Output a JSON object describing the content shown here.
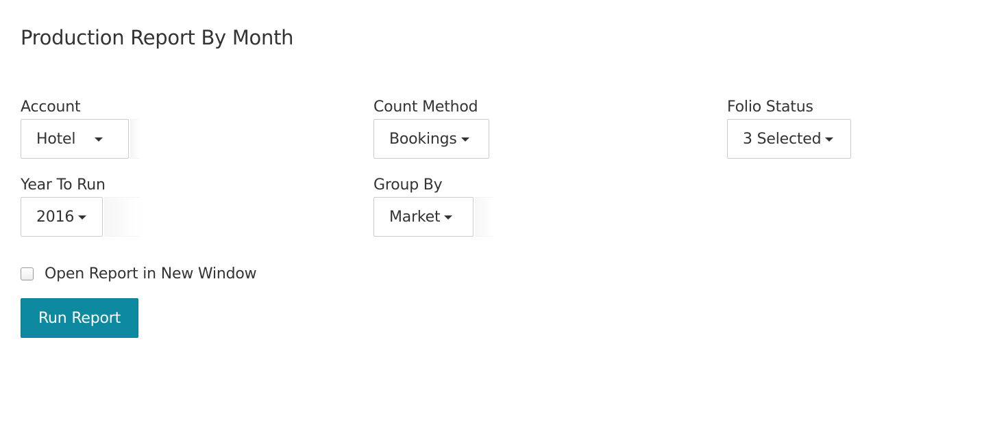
{
  "page": {
    "title": "Production Report By Month"
  },
  "filters": {
    "account": {
      "label": "Account",
      "value": "Hotel"
    },
    "count_method": {
      "label": "Count Method",
      "value": "Bookings"
    },
    "folio_status": {
      "label": "Folio Status",
      "value": "3 Selected"
    },
    "year_to_run": {
      "label": "Year To Run",
      "value": "2016"
    },
    "group_by": {
      "label": "Group By",
      "value": "Market"
    }
  },
  "options": {
    "open_new_window": {
      "label": "Open Report in New Window",
      "checked": false
    }
  },
  "actions": {
    "run_report": "Run Report"
  },
  "colors": {
    "primary_button": "#0e8aa0",
    "text": "#333333",
    "border": "#cccccc"
  }
}
